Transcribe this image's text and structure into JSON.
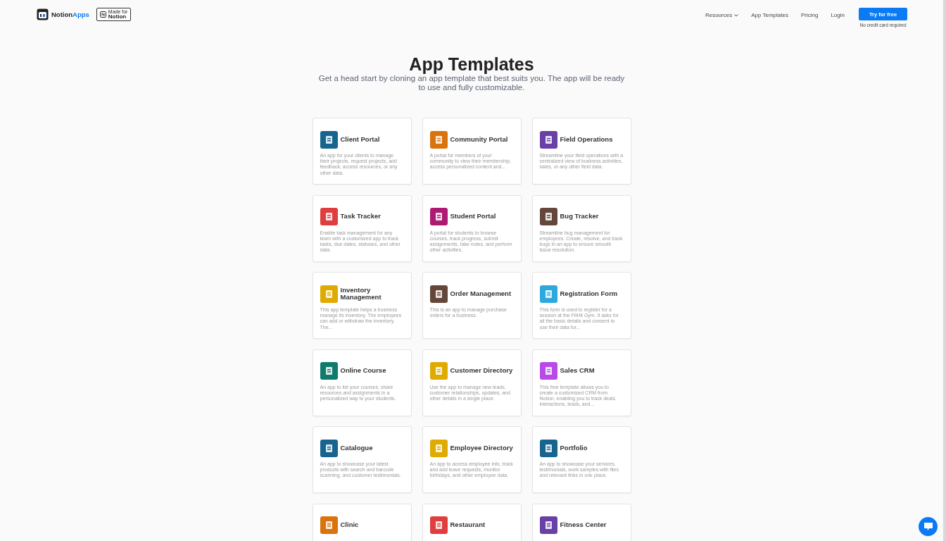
{
  "header": {
    "brand_main": "Notion",
    "brand_accent": "Apps",
    "badge_top": "Made for",
    "badge_bottom": "Notion",
    "nav": [
      {
        "label": "Resources",
        "dropdown": true
      },
      {
        "label": "App Templates",
        "dropdown": false
      },
      {
        "label": "Pricing",
        "dropdown": false
      },
      {
        "label": "Login",
        "dropdown": false
      }
    ],
    "cta": "Try for free",
    "cta_note": "No credit card required"
  },
  "hero": {
    "title": "App Templates",
    "subtitle": "Get a head start by cloning an app template that best suits you. The app will be ready to use and fully customizable."
  },
  "templates": [
    {
      "title": "Client Portal",
      "color": "#17658f",
      "description": "An app for your clients to manage their projects, request projects, add feedback, access resources, or any other data."
    },
    {
      "title": "Community Portal",
      "color": "#d9730d",
      "description": "A portal for members of your community to view their membership, access personalized content and..."
    },
    {
      "title": "Field Operations",
      "color": "#6940a5",
      "description": "Streamline your field operations with a centralized view of business activities, sales, or any other field data."
    },
    {
      "title": "Task Tracker",
      "color": "#e03e3e",
      "description": "Enable task management for any team with a customized app to track tasks, due dates, statuses, and other data."
    },
    {
      "title": "Student Portal",
      "color": "#ad1a72",
      "description": "A portal for students to browse courses, track progress, submit assignments, take notes, and perform other activities."
    },
    {
      "title": "Bug Tracker",
      "color": "#64473a",
      "description": "Streamline bug management for employees. Create, resolve, and track bugs in an app to ensure smooth issue resolution."
    },
    {
      "title": "Inventory Management",
      "color": "#dfab01",
      "description": "This app template helps a business manage its inventory. The employees can add or withdraw the inventory. The..."
    },
    {
      "title": "Order Management",
      "color": "#64473a",
      "description": "This is an app to manage purchase orders for a business."
    },
    {
      "title": "Registration Form",
      "color": "#2ea9de",
      "description": "This form is used to register for a session at the FitHit Gym. It asks for all the basic details and consent to use their data for..."
    },
    {
      "title": "Online Course",
      "color": "#0f7b6c",
      "description": "An app to list your courses, share resources and assignments in a personalized way to your students."
    },
    {
      "title": "Customer Directory",
      "color": "#dfab01",
      "description": "Use the app to manage new leads, customer relationships, updates, and other details in a single place."
    },
    {
      "title": "Sales CRM",
      "color": "#b84be8",
      "description": "This free template allows you to create a customized CRM from Notion, enabling you to track deals, interactions, leads, and..."
    },
    {
      "title": "Catalogue",
      "color": "#17658f",
      "description": "An app to showcase your latest products with search and barcode scanning, and customer testimonials."
    },
    {
      "title": "Employee Directory",
      "color": "#dfab01",
      "description": "An app to access employee info, track and add leave requests, monitor birthdays, and other employee data."
    },
    {
      "title": "Portfolio",
      "color": "#17658f",
      "description": "An app to showcase your services, testimonials, work samples with files and relevant links in one place."
    },
    {
      "title": "Clinic",
      "color": "#d9730d"
    },
    {
      "title": "Restaurant",
      "color": "#e03e3e"
    },
    {
      "title": "Fitness Center",
      "color": "#6940a5"
    }
  ]
}
